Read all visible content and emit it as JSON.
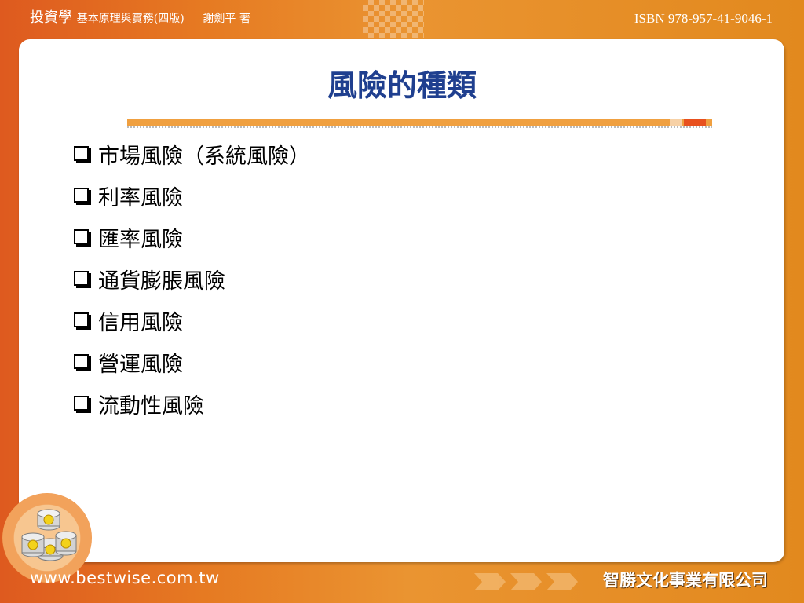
{
  "header": {
    "book_title": "投資學",
    "book_subtitle": "基本原理與實務(四版)",
    "author": "謝劍平 著",
    "isbn": "ISBN 978-957-41-9046-1"
  },
  "slide": {
    "title": "風險的種類",
    "bullets": [
      "市場風險（系統風險）",
      "利率風險",
      "匯率風險",
      "通貨膨脹風險",
      "信用風險",
      "營運風險",
      "流動性風險"
    ]
  },
  "footer": {
    "url": "www.bestwise.com.tw",
    "publisher": "智勝文化事業有限公司",
    "logo_icon": "coin-stack-icon"
  },
  "colors": {
    "accent_orange": "#e4891f",
    "title_blue": "#1f3f8f",
    "rule_orange": "#f0a040",
    "rule_red": "#e8501e"
  }
}
